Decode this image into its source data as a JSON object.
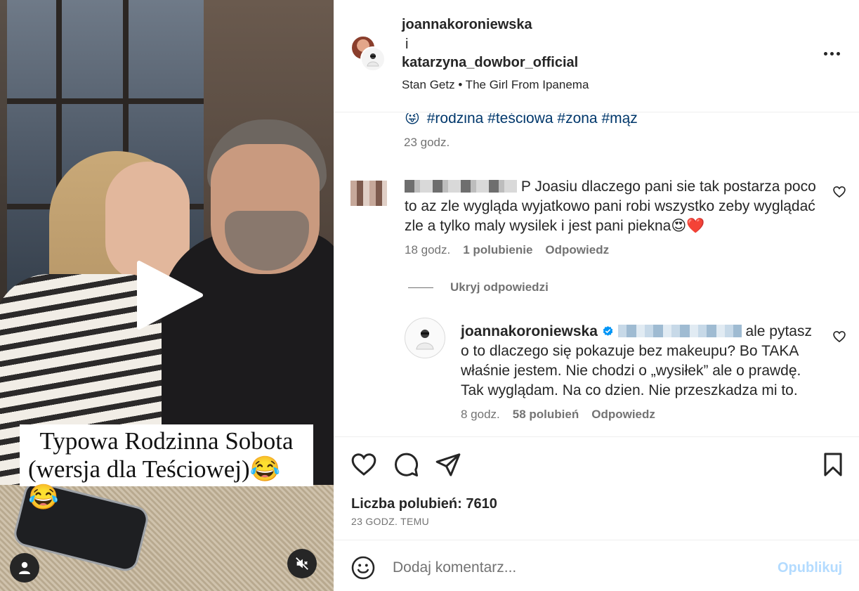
{
  "media": {
    "caption_line1": "Typowa Rodzinna Sobota",
    "caption_line2": "(wersja dla Teściowej)😂😂"
  },
  "header": {
    "user1": "joannakoroniewska",
    "and": "i",
    "user2": "katarzyna_dowbor_official",
    "music": "Stan Getz • The Girl From Ipanema"
  },
  "post": {
    "emoji": "😜",
    "hashtags": [
      "#rodzina",
      "#teściowa",
      "#żona",
      "#mąż"
    ],
    "time": "23 godz."
  },
  "comment": {
    "visible_username_fragment": "P",
    "text": "Joasiu dlaczego pani sie tak postarza poco to az zle wygląda wyjatkowo pani robi wszystko zeby wyglądać zle a tylko maly wysilek i jest pani piekna😍❤️",
    "time": "18 godz.",
    "likes": "1 polubienie",
    "reply": "Odpowiedz"
  },
  "hide_replies": "Ukryj odpowiedzi",
  "reply": {
    "username": "joannakoroniewska",
    "text": "ale pytasz o to dlaczego się pokazuje bez makeupu? Bo TAKA właśnie jestem. Nie chodzi o „wysiłek” ale o prawdę. Tak wyglądam. Na co dzien. Nie przeszkadza mi to.",
    "time": "8 godz.",
    "likes": "58 polubień",
    "reply": "Odpowiedz"
  },
  "stats": {
    "likes": "Liczba polubień: 7610",
    "ago": "23 GODZ. TEMU"
  },
  "composer": {
    "placeholder": "Dodaj komentarz...",
    "publish": "Opublikuj"
  },
  "icons": {
    "play": "play-icon",
    "mute": "speaker-muted-icon",
    "user": "user-icon",
    "heart": "heart-icon",
    "comment": "comment-icon",
    "share": "paper-plane-icon",
    "save": "bookmark-icon",
    "emoji": "emoji-icon",
    "more": "more-horizontal-icon",
    "verified": "verified-badge-icon"
  },
  "colors": {
    "link": "#00376b",
    "muted": "#737373",
    "publish_disabled": "#b3dbff",
    "verified": "#0095f6"
  }
}
